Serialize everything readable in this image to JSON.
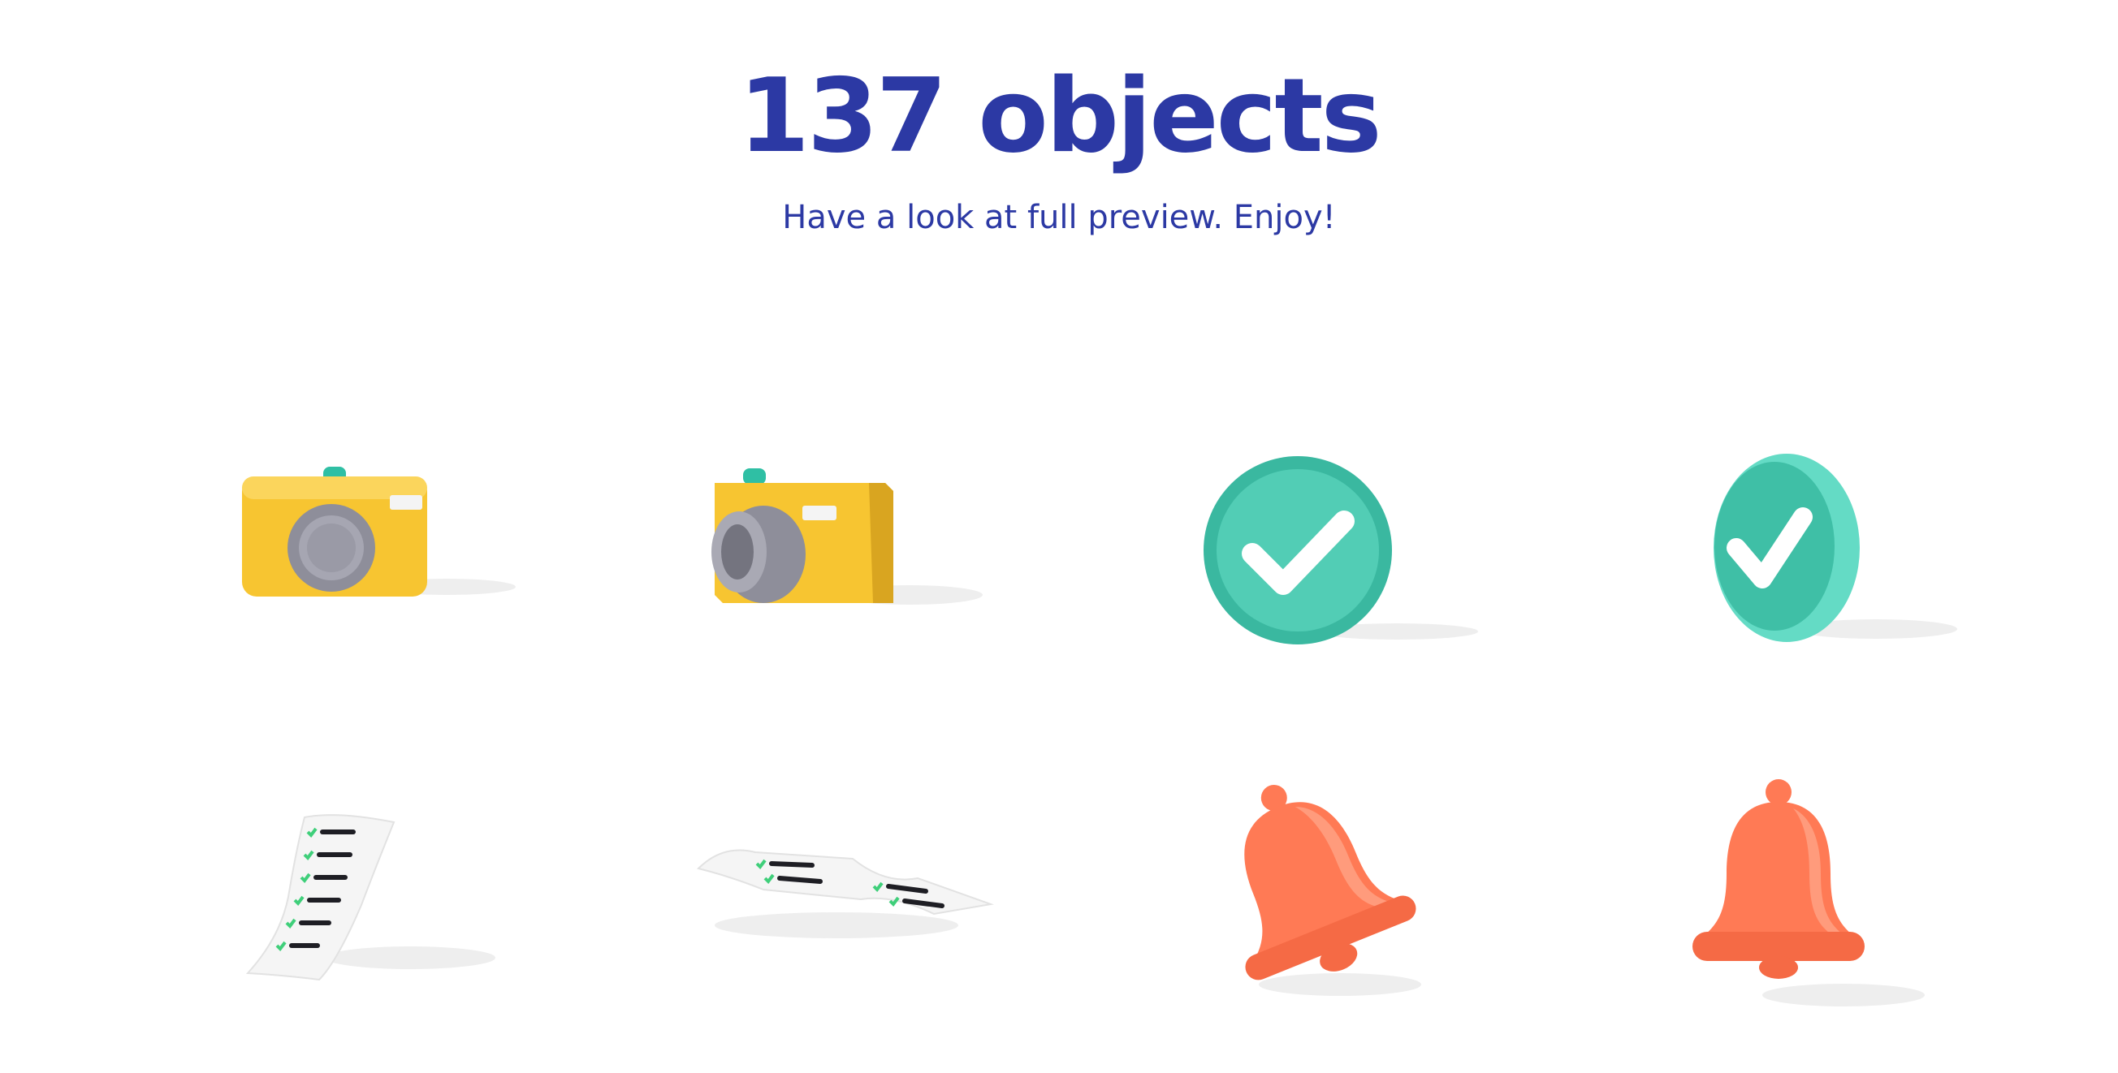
{
  "header": {
    "title": "137 objects",
    "subtitle": "Have a look at full preview. Enjoy!"
  },
  "objects": [
    {
      "icon": "camera-icon",
      "view": "front"
    },
    {
      "icon": "camera-icon",
      "view": "angled"
    },
    {
      "icon": "check-badge-icon",
      "view": "front"
    },
    {
      "icon": "check-badge-icon",
      "view": "angled"
    },
    {
      "icon": "checklist-receipt-icon",
      "view": "standing"
    },
    {
      "icon": "checklist-receipt-icon",
      "view": "lying"
    },
    {
      "icon": "bell-icon",
      "view": "tilted"
    },
    {
      "icon": "bell-icon",
      "view": "upright"
    }
  ],
  "colors": {
    "heading": "#2c39a4",
    "camera_body": "#f7c531",
    "camera_lens": "#9c9ca8",
    "camera_button": "#2fbfa4",
    "check_badge": "#52cdb5",
    "bell": "#ff7a55",
    "receipt_check": "#3fcf7a",
    "receipt_line": "#1e1e24"
  }
}
